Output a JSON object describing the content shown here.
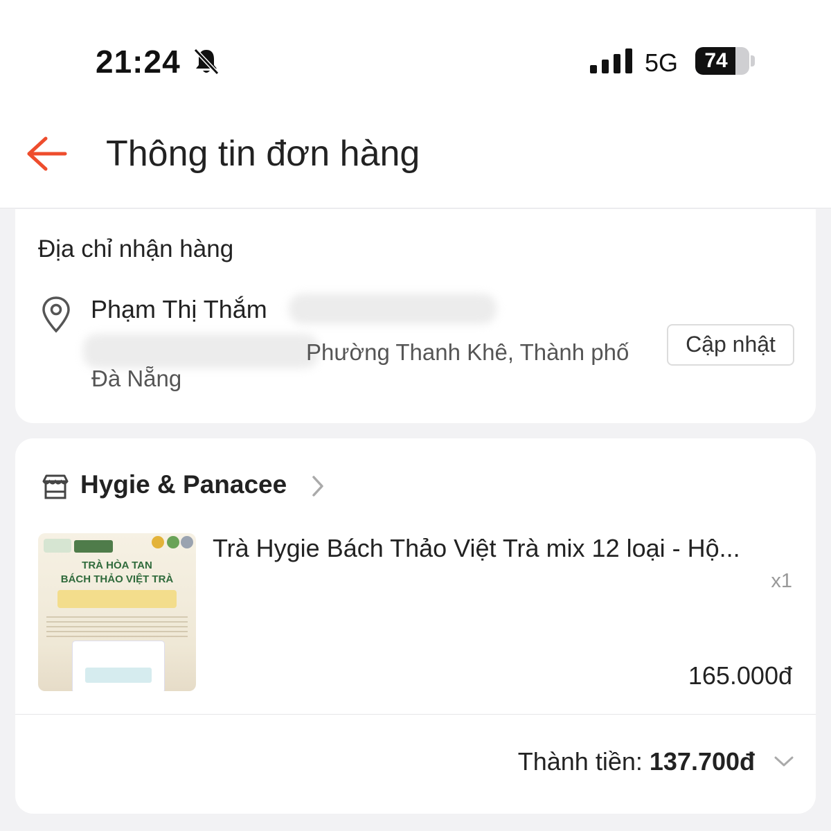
{
  "status_bar": {
    "time": "21:24",
    "network": "5G",
    "battery": "74",
    "battery_level": 0.74,
    "icons": [
      "bell-slash-icon",
      "signal-icon",
      "battery-icon"
    ]
  },
  "header": {
    "title": "Thông tin đơn hàng",
    "back_icon": "arrow-left-icon",
    "accent_color": "#ee4d2d"
  },
  "address": {
    "section_title": "Địa chỉ nhận hàng",
    "recipient_name": "Phạm Thị Thắm",
    "address_line": "Phường Thanh Khê, Thành phố",
    "address_city": "Đà Nẵng",
    "update_button": "Cập nhật",
    "icon": "location-pin-icon"
  },
  "order": {
    "shop_name": "Hygie & Panacee",
    "shop_icon": "store-icon",
    "product_name": "Trà Hygie Bách Thảo Việt Trà mix 12 loại - Hộ...",
    "quantity": "x1",
    "price": "165.000đ",
    "total_label": "Thành tiền:",
    "total_value": "137.700đ",
    "thumbnail": {
      "line1": "TRÀ HÒA TAN",
      "line2": "BÁCH THẢO VIỆT TRÀ"
    }
  }
}
